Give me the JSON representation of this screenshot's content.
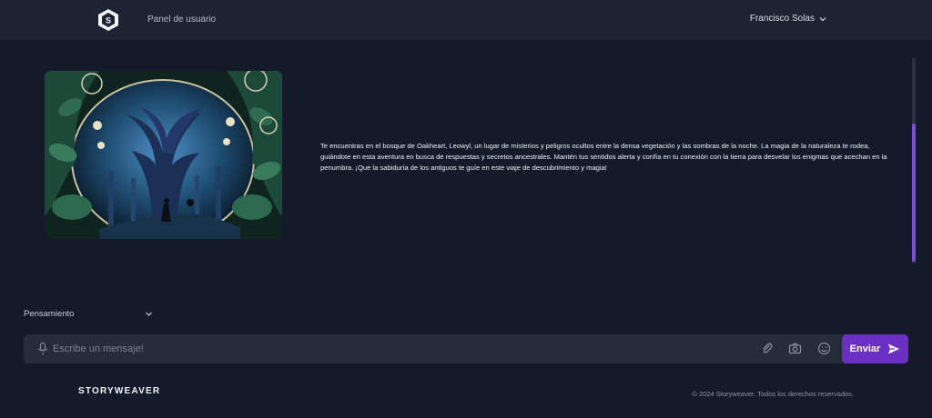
{
  "header": {
    "logo_letter": "S",
    "nav_link": "Panel de usuario",
    "user_name": "Francisco Solas"
  },
  "story": {
    "image_subject": "forest-tree-illustration",
    "text": "Te encuentras en el bosque de Oakheart, Leowyl, un lugar de misterios y peligros ocultos entre la densa vegetación y las sombras de la noche. La magia de la naturaleza te rodea, guiándote en esta aventura en busca de respuestas y secretos ancestrales. Mantén tus sentidos alerta y confía en tu conexión con la tierra para desvelar los enigmas que acechan en la penumbra. ¡Que la sabiduría de los antiguos te guíe en este viaje de descubrimiento y magia!"
  },
  "composer": {
    "mode_selected": "Pensamiento",
    "placeholder": "Escribe un mensaje!",
    "send_label": "Enviar"
  },
  "footer": {
    "brand": "STORYWEAVER",
    "copyright": "© 2024 Storyweaver. Todos los derechos reservados."
  },
  "colors": {
    "background": "#141a2a",
    "topbar": "#1c2434",
    "accent": "#6c2fc4",
    "scroll_thumb": "#7b4fd6"
  }
}
